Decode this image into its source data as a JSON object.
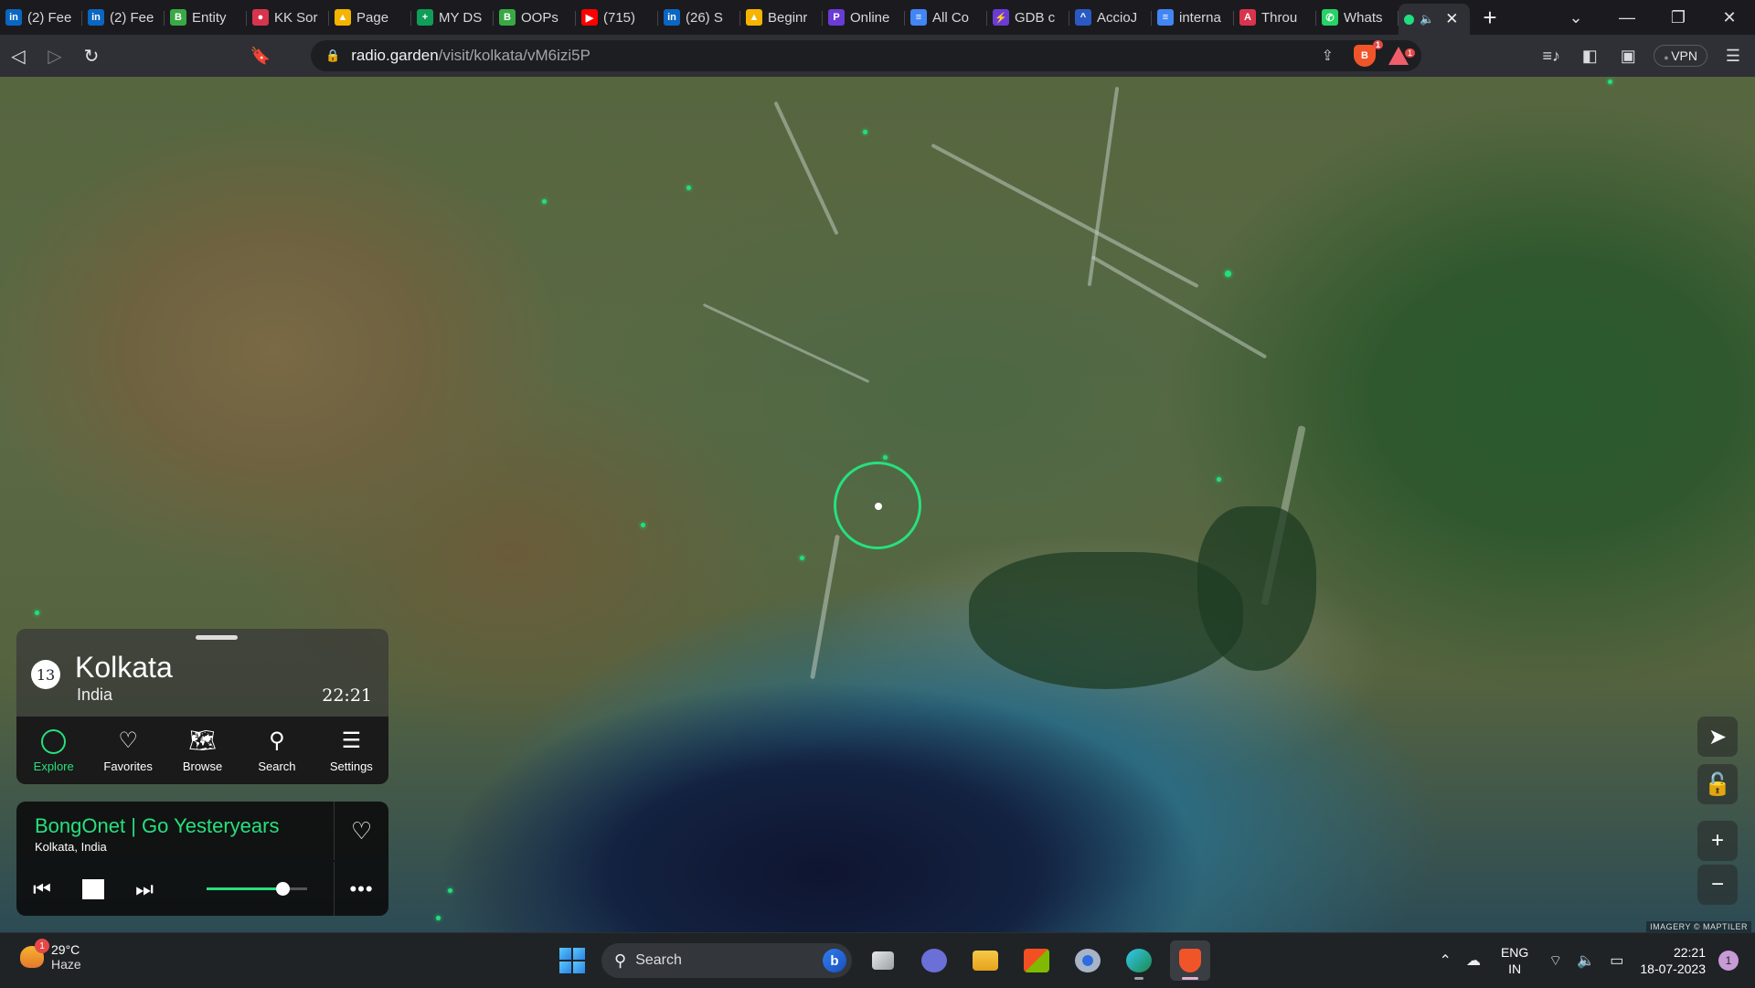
{
  "browser": {
    "tabs": [
      {
        "title": "(2) Fee",
        "icon": "linkedin-icon",
        "color": "#0a66c2",
        "glyph": "in"
      },
      {
        "title": "(2) Fee",
        "icon": "linkedin-icon",
        "color": "#0a66c2",
        "glyph": "in"
      },
      {
        "title": "Entity",
        "icon": "b-green-icon",
        "color": "#3aa845",
        "glyph": "B"
      },
      {
        "title": "KK Sor",
        "icon": "kk-icon",
        "color": "#d9344d",
        "glyph": "●"
      },
      {
        "title": "Page",
        "icon": "google-drive-icon",
        "color": "#f4b400",
        "glyph": "▲"
      },
      {
        "title": "MY DS",
        "icon": "google-sheets-icon",
        "color": "#0f9d58",
        "glyph": "+"
      },
      {
        "title": "OOPs",
        "icon": "b-green-icon",
        "color": "#3aa845",
        "glyph": "B"
      },
      {
        "title": "(715)",
        "icon": "youtube-icon",
        "color": "#ff0000",
        "glyph": "▶"
      },
      {
        "title": "(26) S",
        "icon": "linkedin-icon",
        "color": "#0a66c2",
        "glyph": "in"
      },
      {
        "title": "Beginr",
        "icon": "google-drive-icon",
        "color": "#f4b400",
        "glyph": "▲"
      },
      {
        "title": "Online",
        "icon": "p-purple-icon",
        "color": "#6b3bd6",
        "glyph": "P"
      },
      {
        "title": "All Co",
        "icon": "google-docs-icon",
        "color": "#4285f4",
        "glyph": "≡"
      },
      {
        "title": "GDB c",
        "icon": "gdb-icon",
        "color": "#6b3bd6",
        "glyph": "⚡"
      },
      {
        "title": "AccioJ",
        "icon": "accio-icon",
        "color": "#2b59c3",
        "glyph": "^"
      },
      {
        "title": "interna",
        "icon": "google-docs-icon",
        "color": "#4285f4",
        "glyph": "≡"
      },
      {
        "title": "Throu",
        "icon": "acrobat-icon",
        "color": "#d9344d",
        "glyph": "A"
      },
      {
        "title": "Whats",
        "icon": "whatsapp-icon",
        "color": "#25d366",
        "glyph": "✆"
      }
    ],
    "url_host": "radio.garden",
    "url_path": "/visit/kolkata/vM6izi5P",
    "shield_count": "1",
    "rewards_count": "1",
    "vpn_label": "VPN"
  },
  "map": {
    "attribution": "IMAGERY © MAPTILER",
    "accent": "#27e07e"
  },
  "place": {
    "station_count": "13",
    "name": "Kolkata",
    "country": "India",
    "local_time": "22:21"
  },
  "nav": [
    {
      "label": "Explore",
      "icon": "explore-circle-icon",
      "active": true
    },
    {
      "label": "Favorites",
      "icon": "heart-icon",
      "active": false
    },
    {
      "label": "Browse",
      "icon": "map-browse-icon",
      "active": false
    },
    {
      "label": "Search",
      "icon": "search-icon",
      "active": false
    },
    {
      "label": "Settings",
      "icon": "menu-icon",
      "active": false
    }
  ],
  "player": {
    "station_name": "BongOnet | Go Yesteryears",
    "station_location": "Kolkata, India",
    "volume": 0.75
  },
  "taskbar": {
    "weather_temp": "29°C",
    "weather_condition": "Haze",
    "weather_badge": "1",
    "search_placeholder": "Search",
    "language": "ENG",
    "region": "IN",
    "time": "22:21",
    "date": "18-07-2023",
    "notification_count": "1"
  }
}
